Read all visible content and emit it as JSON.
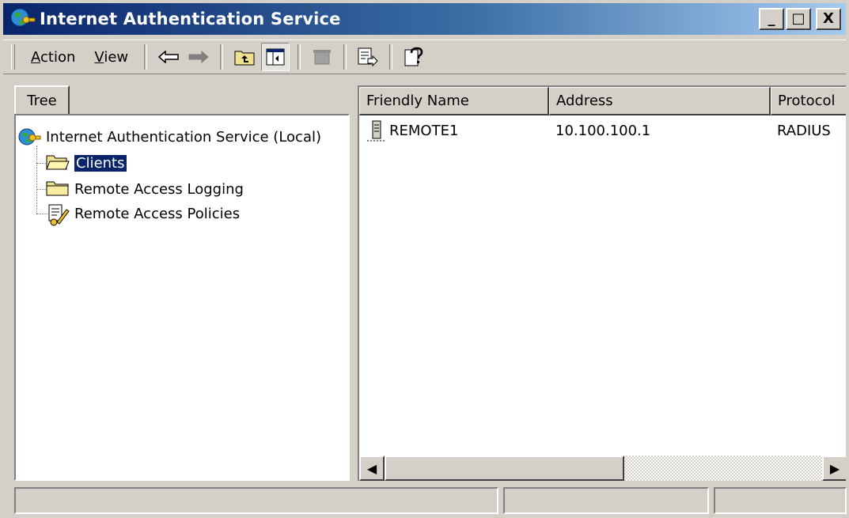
{
  "window": {
    "title": "Internet Authentication Service",
    "min_label": "_",
    "max_label": "□",
    "close_label": "X"
  },
  "toolbar": {
    "menu": [
      {
        "label": "Action",
        "accel": "A"
      },
      {
        "label": "View",
        "accel": "V"
      }
    ],
    "icons": [
      "back-arrow-icon",
      "forward-arrow-icon",
      "up-folder-icon",
      "show-hide-tree-icon",
      "delete-icon",
      "export-list-icon",
      "help-icon"
    ]
  },
  "tree": {
    "tab_label": "Tree",
    "root": "Internet Authentication Service (Local)",
    "items": [
      {
        "label": "Clients",
        "icon": "open-folder-icon",
        "selected": true
      },
      {
        "label": "Remote Access Logging",
        "icon": "folder-icon",
        "selected": false
      },
      {
        "label": "Remote Access Policies",
        "icon": "policy-icon",
        "selected": false
      }
    ]
  },
  "list": {
    "columns": [
      "Friendly Name",
      "Address",
      "Protocol"
    ],
    "rows": [
      {
        "name": "REMOTE1",
        "address": "10.100.100.1",
        "protocol": "RADIUS"
      }
    ]
  },
  "colors": {
    "title_start": "#0a246a",
    "title_end": "#a6caf0",
    "selection": "#0a246a",
    "chrome": "#d4d0c8"
  }
}
